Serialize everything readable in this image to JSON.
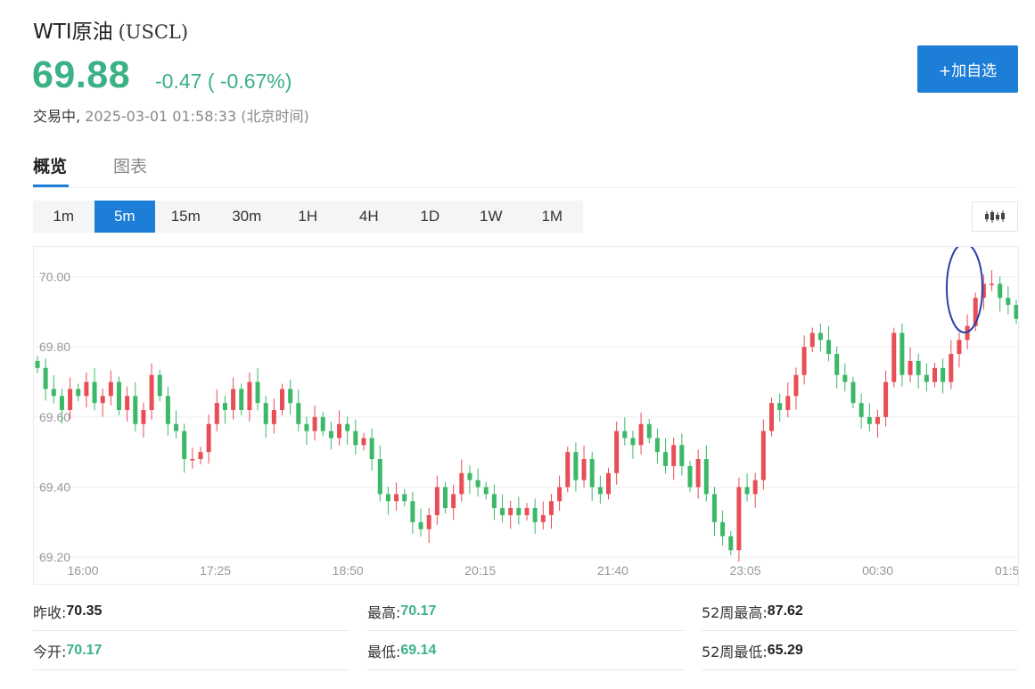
{
  "header": {
    "name": "WTI原油",
    "code": "(USCL)",
    "price": "69.88",
    "change": "-0.47 ( -0.67%)",
    "status_label": "交易中,",
    "timestamp": "2025-03-01 01:58:33 (北京时间)",
    "add_watchlist": "+加自选"
  },
  "tabs": [
    {
      "label": "概览",
      "active": true
    },
    {
      "label": "图表",
      "active": false
    }
  ],
  "periods": [
    {
      "label": "1m",
      "active": false
    },
    {
      "label": "5m",
      "active": true
    },
    {
      "label": "15m",
      "active": false
    },
    {
      "label": "30m",
      "active": false
    },
    {
      "label": "1H",
      "active": false
    },
    {
      "label": "4H",
      "active": false
    },
    {
      "label": "1D",
      "active": false
    },
    {
      "label": "1W",
      "active": false
    },
    {
      "label": "1M",
      "active": false
    }
  ],
  "chart_type_icon": "candlestick-icon",
  "chart_data": {
    "type": "candlestick",
    "y_ticks": [
      "70.00",
      "69.80",
      "69.60",
      "69.40",
      "69.20"
    ],
    "ylim": [
      69.18,
      70.06
    ],
    "x_ticks": [
      "16:00",
      "17:25",
      "18:50",
      "20:15",
      "21:40",
      "23:05",
      "00:30",
      "01:5"
    ],
    "grid": true,
    "colors": {
      "up": "#e84e55",
      "down": "#3bb868"
    },
    "closes": [
      69.74,
      69.68,
      69.66,
      69.62,
      69.68,
      69.66,
      69.7,
      69.64,
      69.66,
      69.7,
      69.62,
      69.66,
      69.58,
      69.62,
      69.72,
      69.66,
      69.58,
      69.56,
      69.48,
      69.48,
      69.5,
      69.58,
      69.64,
      69.62,
      69.68,
      69.62,
      69.7,
      69.64,
      69.58,
      69.62,
      69.68,
      69.64,
      69.58,
      69.56,
      69.6,
      69.56,
      69.54,
      69.58,
      69.56,
      69.52,
      69.54,
      69.48,
      69.38,
      69.36,
      69.38,
      69.36,
      69.3,
      69.28,
      69.32,
      69.4,
      69.34,
      69.38,
      69.44,
      69.42,
      69.4,
      69.38,
      69.34,
      69.32,
      69.34,
      69.32,
      69.34,
      69.3,
      69.32,
      69.36,
      69.4,
      69.5,
      69.42,
      69.48,
      69.4,
      69.38,
      69.44,
      69.56,
      69.54,
      69.52,
      69.58,
      69.54,
      69.5,
      69.46,
      69.52,
      69.46,
      69.4,
      69.48,
      69.38,
      69.3,
      69.26,
      69.22,
      69.4,
      69.38,
      69.42,
      69.56,
      69.64,
      69.62,
      69.66,
      69.72,
      69.8,
      69.84,
      69.82,
      69.78,
      69.72,
      69.7,
      69.64,
      69.6,
      69.58,
      69.6,
      69.7,
      69.84,
      69.72,
      69.76,
      69.72,
      69.7,
      69.74,
      69.7,
      69.78,
      69.82,
      69.86,
      69.94,
      69.98,
      69.98,
      69.94,
      69.92,
      69.88
    ],
    "last_price_marker": "circle"
  },
  "stats": [
    {
      "label": "昨收:",
      "value": "70.35",
      "color": "default"
    },
    {
      "label": "最高:",
      "value": "70.17",
      "color": "green"
    },
    {
      "label": "52周最高:",
      "value": "87.62",
      "color": "default"
    },
    {
      "label": "今开:",
      "value": "70.17",
      "color": "green"
    },
    {
      "label": "最低:",
      "value": "69.14",
      "color": "green"
    },
    {
      "label": "52周最低:",
      "value": "65.29",
      "color": "default"
    }
  ]
}
